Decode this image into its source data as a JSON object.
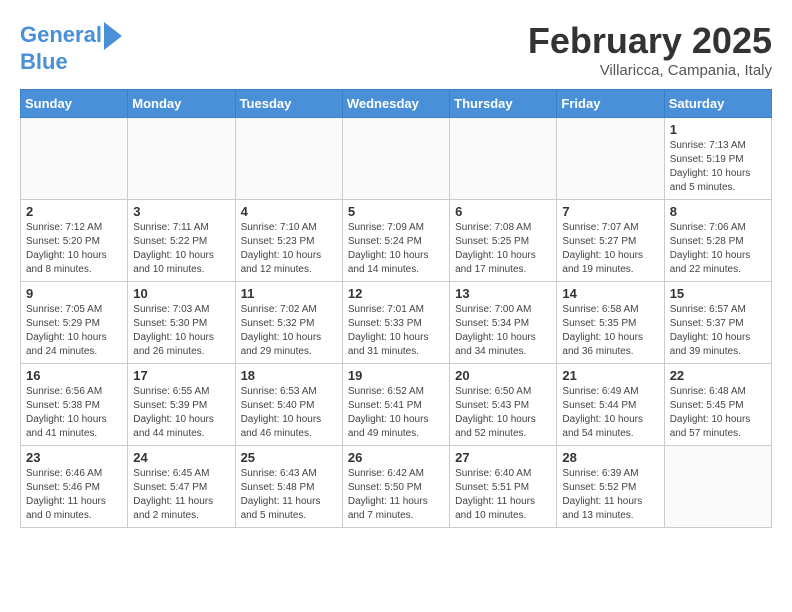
{
  "logo": {
    "line1": "General",
    "line2": "Blue"
  },
  "title": "February 2025",
  "subtitle": "Villaricca, Campania, Italy",
  "weekdays": [
    "Sunday",
    "Monday",
    "Tuesday",
    "Wednesday",
    "Thursday",
    "Friday",
    "Saturday"
  ],
  "weeks": [
    [
      {
        "day": "",
        "info": ""
      },
      {
        "day": "",
        "info": ""
      },
      {
        "day": "",
        "info": ""
      },
      {
        "day": "",
        "info": ""
      },
      {
        "day": "",
        "info": ""
      },
      {
        "day": "",
        "info": ""
      },
      {
        "day": "1",
        "info": "Sunrise: 7:13 AM\nSunset: 5:19 PM\nDaylight: 10 hours\nand 5 minutes."
      }
    ],
    [
      {
        "day": "2",
        "info": "Sunrise: 7:12 AM\nSunset: 5:20 PM\nDaylight: 10 hours\nand 8 minutes."
      },
      {
        "day": "3",
        "info": "Sunrise: 7:11 AM\nSunset: 5:22 PM\nDaylight: 10 hours\nand 10 minutes."
      },
      {
        "day": "4",
        "info": "Sunrise: 7:10 AM\nSunset: 5:23 PM\nDaylight: 10 hours\nand 12 minutes."
      },
      {
        "day": "5",
        "info": "Sunrise: 7:09 AM\nSunset: 5:24 PM\nDaylight: 10 hours\nand 14 minutes."
      },
      {
        "day": "6",
        "info": "Sunrise: 7:08 AM\nSunset: 5:25 PM\nDaylight: 10 hours\nand 17 minutes."
      },
      {
        "day": "7",
        "info": "Sunrise: 7:07 AM\nSunset: 5:27 PM\nDaylight: 10 hours\nand 19 minutes."
      },
      {
        "day": "8",
        "info": "Sunrise: 7:06 AM\nSunset: 5:28 PM\nDaylight: 10 hours\nand 22 minutes."
      }
    ],
    [
      {
        "day": "9",
        "info": "Sunrise: 7:05 AM\nSunset: 5:29 PM\nDaylight: 10 hours\nand 24 minutes."
      },
      {
        "day": "10",
        "info": "Sunrise: 7:03 AM\nSunset: 5:30 PM\nDaylight: 10 hours\nand 26 minutes."
      },
      {
        "day": "11",
        "info": "Sunrise: 7:02 AM\nSunset: 5:32 PM\nDaylight: 10 hours\nand 29 minutes."
      },
      {
        "day": "12",
        "info": "Sunrise: 7:01 AM\nSunset: 5:33 PM\nDaylight: 10 hours\nand 31 minutes."
      },
      {
        "day": "13",
        "info": "Sunrise: 7:00 AM\nSunset: 5:34 PM\nDaylight: 10 hours\nand 34 minutes."
      },
      {
        "day": "14",
        "info": "Sunrise: 6:58 AM\nSunset: 5:35 PM\nDaylight: 10 hours\nand 36 minutes."
      },
      {
        "day": "15",
        "info": "Sunrise: 6:57 AM\nSunset: 5:37 PM\nDaylight: 10 hours\nand 39 minutes."
      }
    ],
    [
      {
        "day": "16",
        "info": "Sunrise: 6:56 AM\nSunset: 5:38 PM\nDaylight: 10 hours\nand 41 minutes."
      },
      {
        "day": "17",
        "info": "Sunrise: 6:55 AM\nSunset: 5:39 PM\nDaylight: 10 hours\nand 44 minutes."
      },
      {
        "day": "18",
        "info": "Sunrise: 6:53 AM\nSunset: 5:40 PM\nDaylight: 10 hours\nand 46 minutes."
      },
      {
        "day": "19",
        "info": "Sunrise: 6:52 AM\nSunset: 5:41 PM\nDaylight: 10 hours\nand 49 minutes."
      },
      {
        "day": "20",
        "info": "Sunrise: 6:50 AM\nSunset: 5:43 PM\nDaylight: 10 hours\nand 52 minutes."
      },
      {
        "day": "21",
        "info": "Sunrise: 6:49 AM\nSunset: 5:44 PM\nDaylight: 10 hours\nand 54 minutes."
      },
      {
        "day": "22",
        "info": "Sunrise: 6:48 AM\nSunset: 5:45 PM\nDaylight: 10 hours\nand 57 minutes."
      }
    ],
    [
      {
        "day": "23",
        "info": "Sunrise: 6:46 AM\nSunset: 5:46 PM\nDaylight: 11 hours\nand 0 minutes."
      },
      {
        "day": "24",
        "info": "Sunrise: 6:45 AM\nSunset: 5:47 PM\nDaylight: 11 hours\nand 2 minutes."
      },
      {
        "day": "25",
        "info": "Sunrise: 6:43 AM\nSunset: 5:48 PM\nDaylight: 11 hours\nand 5 minutes."
      },
      {
        "day": "26",
        "info": "Sunrise: 6:42 AM\nSunset: 5:50 PM\nDaylight: 11 hours\nand 7 minutes."
      },
      {
        "day": "27",
        "info": "Sunrise: 6:40 AM\nSunset: 5:51 PM\nDaylight: 11 hours\nand 10 minutes."
      },
      {
        "day": "28",
        "info": "Sunrise: 6:39 AM\nSunset: 5:52 PM\nDaylight: 11 hours\nand 13 minutes."
      },
      {
        "day": "",
        "info": ""
      }
    ]
  ]
}
